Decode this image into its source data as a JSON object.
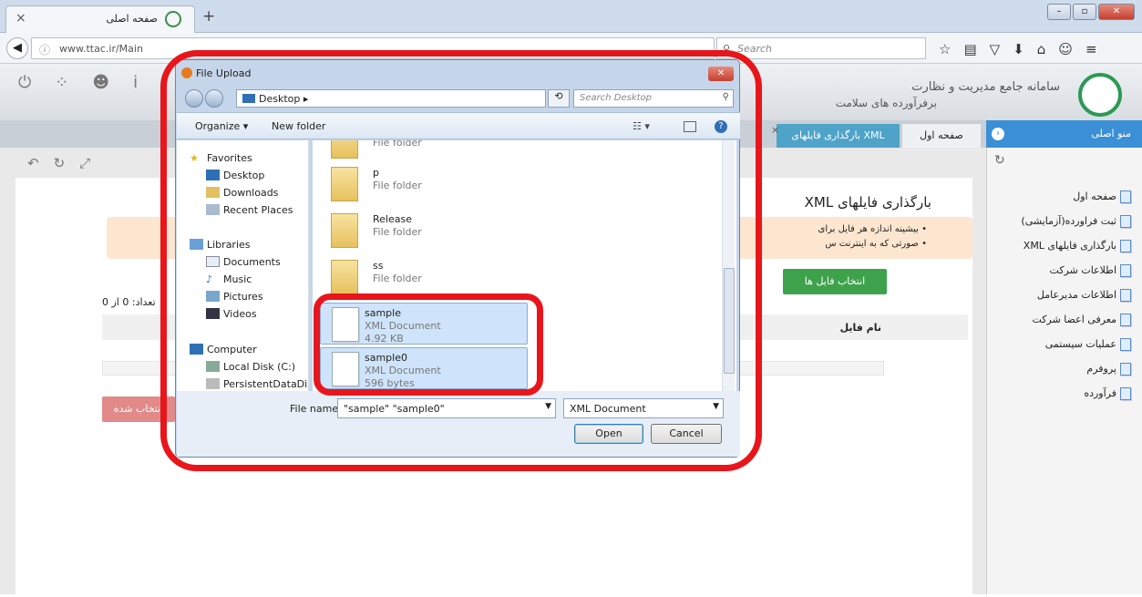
{
  "browser": {
    "tab_title": "صفحه اصلی",
    "new_tab": "+",
    "url": "www.ttac.ir/Main",
    "search_placeholder": "Search"
  },
  "app": {
    "title1": "سامانه جامع مدیریت و نظارت",
    "title2": "برفرآورده های سلامت",
    "tab_home": "صفحه اول",
    "tab_upload": "بارگذاری فایلهای XML",
    "menu": "منو اصلی",
    "sidebar": [
      "صفحه اول",
      "ثبت فراورده(آزمایشی)",
      "بارگذاری فایلهای XML",
      "اطلاعات شرکت",
      "اطلاعات مدیرعامل",
      "معرفی اعضا شرکت",
      "عملیات سیستمی",
      "پروفرم",
      "فرآورده"
    ],
    "heading": "بارگذاری فایلهای XML",
    "notice1": "• بیشینه اندازه هر فایل برای",
    "notice2": "• صورتی که به اینترنت س",
    "pick_button": "انتخاب فایل ها",
    "count_label": "تعداد: 0 از 0",
    "col_file_name": "نام فایل",
    "selected_button": "انتخاب شده"
  },
  "dialog": {
    "title": "File Upload",
    "path": "Desktop",
    "search_placeholder": "Search Desktop",
    "organize": "Organize ▾",
    "new_folder": "New folder",
    "nav": {
      "favorites": "Favorites",
      "desktop": "Desktop",
      "downloads": "Downloads",
      "recent": "Recent Places",
      "libraries": "Libraries",
      "documents": "Documents",
      "music": "Music",
      "pictures": "Pictures",
      "videos": "Videos",
      "computer": "Computer",
      "local_disk": "Local Disk (C:)",
      "persistent": "PersistentDataDis"
    },
    "files": [
      {
        "name": "",
        "kind": "File folder",
        "size": ""
      },
      {
        "name": "p",
        "kind": "File folder",
        "size": ""
      },
      {
        "name": "Release",
        "kind": "File folder",
        "size": ""
      },
      {
        "name": "ss",
        "kind": "File folder",
        "size": ""
      },
      {
        "name": "sample",
        "kind": "XML Document",
        "size": "4.92 KB"
      },
      {
        "name": "sample0",
        "kind": "XML Document",
        "size": "596 bytes"
      }
    ],
    "file_name_label": "File name:",
    "file_name_value": "\"sample\" \"sample0\"",
    "file_type": "XML Document",
    "open": "Open",
    "cancel": "Cancel"
  },
  "colors": {
    "annotation": "#e8161b",
    "accent": "#3b8fd6",
    "green": "#3ea24c"
  }
}
